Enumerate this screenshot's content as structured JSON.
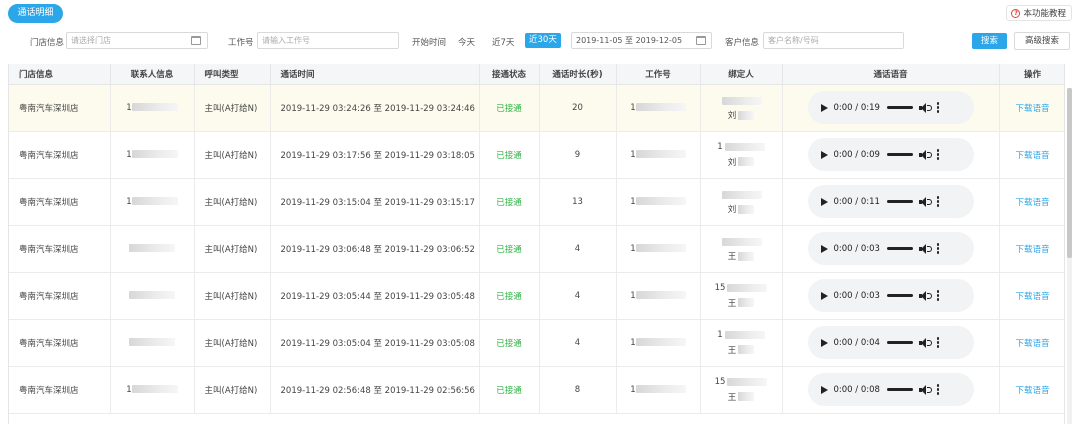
{
  "tab": {
    "label": "通话明细"
  },
  "help": {
    "label": "本功能教程",
    "icon": "question-circle-icon"
  },
  "filters": {
    "store_label": "门店信息",
    "store_placeholder": "请选择门店",
    "job_label": "工作号",
    "job_placeholder": "请输入工作号",
    "start_label": "开始时间",
    "quick": [
      "今天",
      "近7天",
      "近30天"
    ],
    "active_quick": "近30天",
    "date_range": "2019-11-05 至 2019-12-05",
    "customer_label": "客户信息",
    "customer_placeholder": "客户名称/号码",
    "search_label": "搜索",
    "advanced_label": "高级搜索"
  },
  "table": {
    "headers": [
      "门店信息",
      "联系人信息",
      "呼叫类型",
      "通话时间",
      "接通状态",
      "通话时长(秒)",
      "工作号",
      "绑定人",
      "通话语音",
      "操作"
    ],
    "rows": [
      {
        "store": "粤南汽车深圳店",
        "contact": "1",
        "call_type": "主叫(A打给N)",
        "time": "2019-11-29 03:24:26 至 2019-11-29 03:24:46",
        "status": "已接通",
        "duration": "20",
        "job": "1",
        "binder_top": "",
        "binder": "刘",
        "audio": "0:00 / 0:19",
        "action": "下载语音"
      },
      {
        "store": "粤南汽车深圳店",
        "contact": "1",
        "call_type": "主叫(A打给N)",
        "time": "2019-11-29 03:17:56 至 2019-11-29 03:18:05",
        "status": "已接通",
        "duration": "9",
        "job": "1",
        "binder_top": "1",
        "binder": "刘",
        "audio": "0:00 / 0:09",
        "action": "下载语音"
      },
      {
        "store": "粤南汽车深圳店",
        "contact": "1",
        "call_type": "主叫(A打给N)",
        "time": "2019-11-29 03:15:04 至 2019-11-29 03:15:17",
        "status": "已接通",
        "duration": "13",
        "job": "1",
        "binder_top": "",
        "binder": "刘",
        "audio": "0:00 / 0:11",
        "action": "下载语音"
      },
      {
        "store": "粤南汽车深圳店",
        "contact": "",
        "call_type": "主叫(A打给N)",
        "time": "2019-11-29 03:06:48 至 2019-11-29 03:06:52",
        "status": "已接通",
        "duration": "4",
        "job": "1",
        "binder_top": "",
        "binder": "王",
        "audio": "0:00 / 0:03",
        "action": "下载语音"
      },
      {
        "store": "粤南汽车深圳店",
        "contact": "",
        "call_type": "主叫(A打给N)",
        "time": "2019-11-29 03:05:44 至 2019-11-29 03:05:48",
        "status": "已接通",
        "duration": "4",
        "job": "1",
        "binder_top": "15",
        "binder": "王",
        "audio": "0:00 / 0:03",
        "action": "下载语音"
      },
      {
        "store": "粤南汽车深圳店",
        "contact": "",
        "call_type": "主叫(A打给N)",
        "time": "2019-11-29 03:05:04 至 2019-11-29 03:05:08",
        "status": "已接通",
        "duration": "4",
        "job": "1",
        "binder_top": "1",
        "binder": "王",
        "audio": "0:00 / 0:04",
        "action": "下载语音"
      },
      {
        "store": "粤南汽车深圳店",
        "contact": "1",
        "call_type": "主叫(A打给N)",
        "time": "2019-11-29 02:56:48 至 2019-11-29 02:56:56",
        "status": "已接通",
        "duration": "8",
        "job": "1",
        "binder_top": "15",
        "binder": "王",
        "audio": "0:00 / 0:08",
        "action": "下载语音"
      }
    ]
  },
  "colors": {
    "accent": "#2ba6e8",
    "success": "#2fb344",
    "highlight_row": "#fdfbee"
  }
}
